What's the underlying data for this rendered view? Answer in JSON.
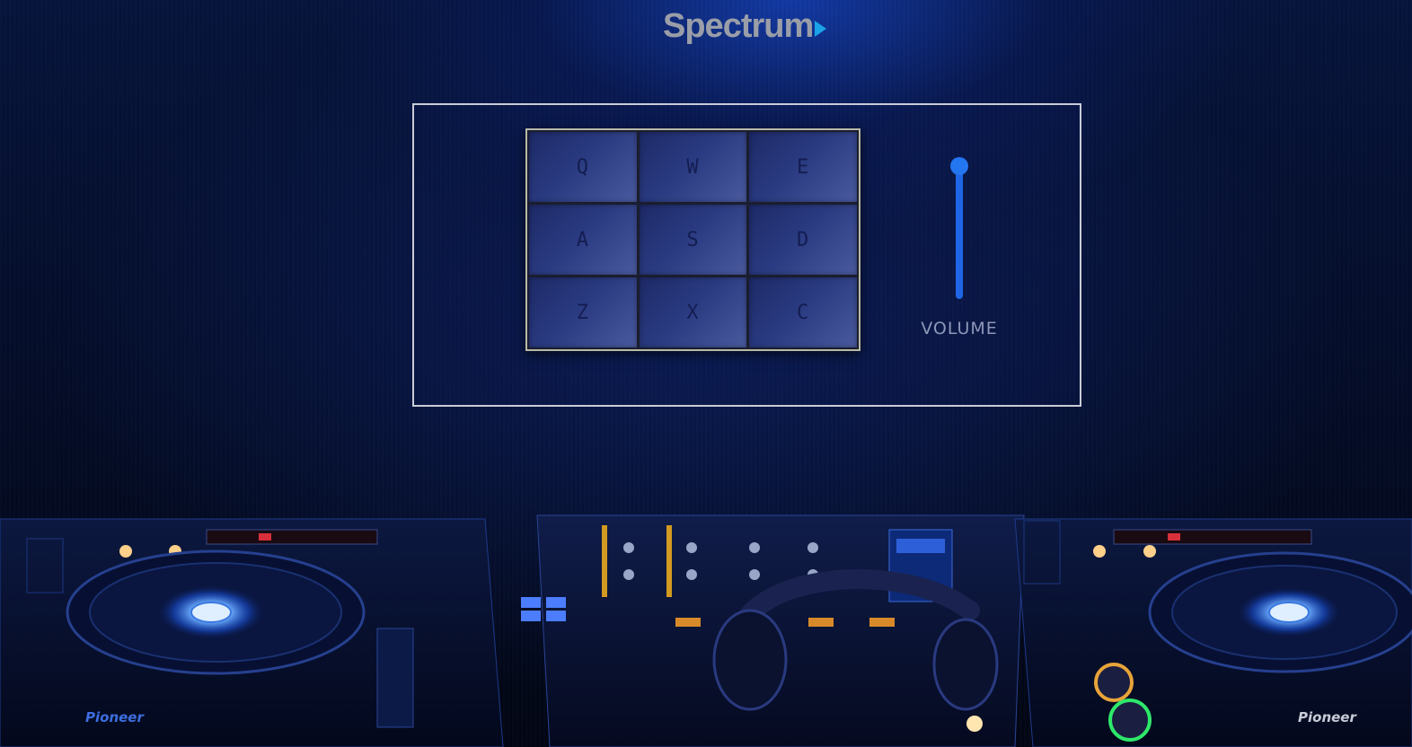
{
  "logo": {
    "text": "Spectrum"
  },
  "pads": [
    {
      "key": "Q"
    },
    {
      "key": "W"
    },
    {
      "key": "E"
    },
    {
      "key": "A"
    },
    {
      "key": "S"
    },
    {
      "key": "D"
    },
    {
      "key": "Z"
    },
    {
      "key": "X"
    },
    {
      "key": "C"
    }
  ],
  "volume": {
    "label": "VOLUME",
    "level": 1.0
  },
  "colors": {
    "accent": "#1f66e6",
    "pad_text": "#141d52",
    "panel_border": "#c9ccd6",
    "logo_arrow": "#1aa3e8"
  },
  "equipment": {
    "left_deck_brand": "Pioneer",
    "right_deck_brand": "Pioneer"
  }
}
